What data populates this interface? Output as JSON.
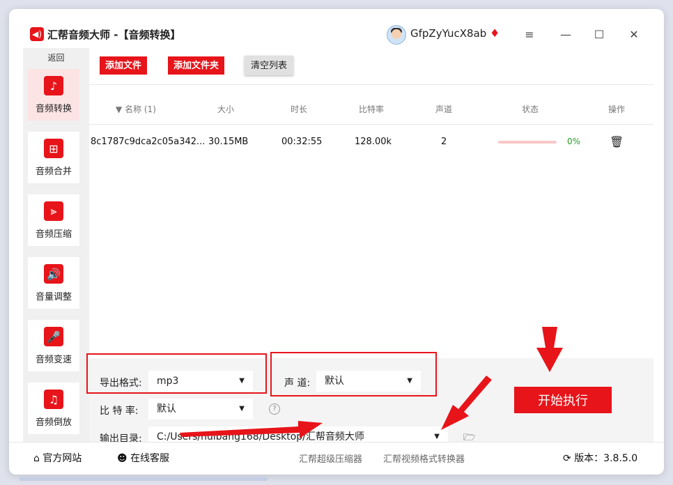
{
  "app": {
    "title": "汇帮音频大师  -【音频转换】",
    "logo_icon": "speaker-icon"
  },
  "user": {
    "name": "GfpZyYucX8ab",
    "vip_icon": "diamond-icon"
  },
  "window_controls": {
    "menu": "≡",
    "minimize": "—",
    "maximize": "☐",
    "close": "✕"
  },
  "sidebar": {
    "back_label": "返回",
    "items": [
      {
        "label": "音频转换",
        "icon": "audio-convert-icon",
        "glyph": "♪",
        "active": true
      },
      {
        "label": "音频合并",
        "icon": "audio-merge-icon",
        "glyph": "⊞"
      },
      {
        "label": "音频压缩",
        "icon": "audio-compress-icon",
        "glyph": "⫸"
      },
      {
        "label": "音量调整",
        "icon": "volume-adjust-icon",
        "glyph": "🔊"
      },
      {
        "label": "音频变速",
        "icon": "audio-speed-icon",
        "glyph": "🎤"
      },
      {
        "label": "音频倒放",
        "icon": "audio-reverse-icon",
        "glyph": "♫"
      }
    ]
  },
  "toolbar": {
    "add_file": "添加文件",
    "add_folder": "添加文件夹",
    "clear_list": "清空列表"
  },
  "table": {
    "columns": [
      "名称 (1)",
      "大小",
      "时长",
      "比特率",
      "声道",
      "状态",
      "操作"
    ],
    "sort_indicator": "▼",
    "rows": [
      {
        "name": "8c1787c9dca2c05a342...",
        "size": "30.15MB",
        "duration": "00:32:55",
        "bitrate": "128.00k",
        "channels": "2",
        "progress": 0,
        "status": "0%"
      }
    ]
  },
  "settings": {
    "format_label": "导出格式:",
    "format_value": "mp3",
    "channel_label": "声 道:",
    "channel_value": "默认",
    "bitrate_label": "比 特 率:",
    "bitrate_value": "默认",
    "help_glyph": "?",
    "output_label": "输出目录:",
    "output_value": "C:/Users/huibang168/Desktop/汇帮音频大师"
  },
  "start_button": "开始执行",
  "footer": {
    "website": "官方网站",
    "support": "在线客服",
    "link1": "汇帮超级压缩器",
    "link2": "汇帮视频格式转换器",
    "version": "版本：3.8.5.0"
  },
  "colors": {
    "accent": "#e7141a",
    "success": "#2a9d2a"
  }
}
